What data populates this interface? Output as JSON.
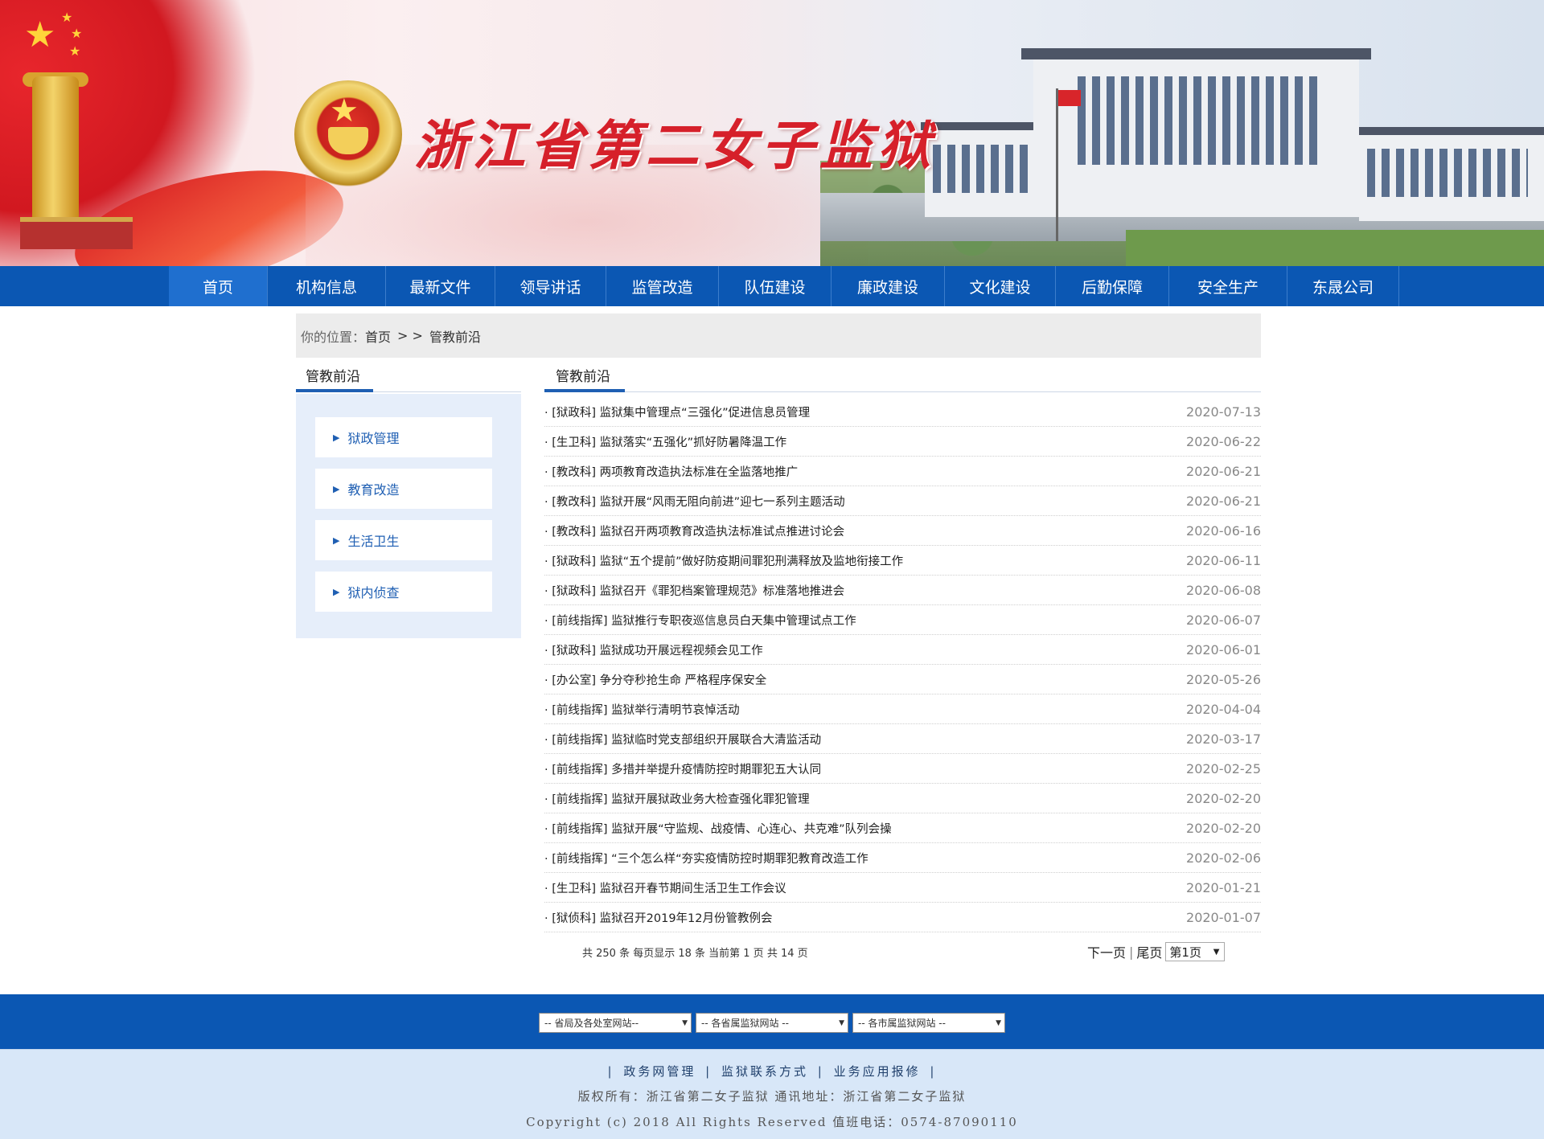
{
  "site": {
    "title": "浙江省第二女子监狱"
  },
  "nav": {
    "items": [
      {
        "label": "首页"
      },
      {
        "label": "机构信息"
      },
      {
        "label": "最新文件"
      },
      {
        "label": "领导讲话"
      },
      {
        "label": "监管改造"
      },
      {
        "label": "队伍建设"
      },
      {
        "label": "廉政建设"
      },
      {
        "label": "文化建设"
      },
      {
        "label": "后勤保障"
      },
      {
        "label": "安全生产"
      },
      {
        "label": "东晟公司"
      }
    ],
    "active_index": 0
  },
  "breadcrumb": {
    "prefix": "你的位置：",
    "home": "首页",
    "separator": "> >",
    "current": "管教前沿"
  },
  "sidebar": {
    "heading": "管教前沿",
    "items": [
      {
        "label": "狱政管理"
      },
      {
        "label": "教育改造"
      },
      {
        "label": "生活卫生"
      },
      {
        "label": "狱内侦查"
      }
    ]
  },
  "main": {
    "heading": "管教前沿",
    "articles": [
      {
        "title": "· [狱政科] 监狱集中管理点“三强化”促进信息员管理",
        "date": "2020-07-13"
      },
      {
        "title": "· [生卫科] 监狱落实“五强化”抓好防暑降温工作",
        "date": "2020-06-22"
      },
      {
        "title": "· [教改科] 两项教育改造执法标准在全监落地推广",
        "date": "2020-06-21"
      },
      {
        "title": "· [教改科] 监狱开展“风雨无阻向前进”迎七一系列主题活动",
        "date": "2020-06-21"
      },
      {
        "title": "· [教改科] 监狱召开两项教育改造执法标准试点推进讨论会",
        "date": "2020-06-16"
      },
      {
        "title": "· [狱政科] 监狱“五个提前”做好防疫期间罪犯刑满释放及监地衔接工作",
        "date": "2020-06-11"
      },
      {
        "title": "· [狱政科] 监狱召开《罪犯档案管理规范》标准落地推进会",
        "date": "2020-06-08"
      },
      {
        "title": "· [前线指挥] 监狱推行专职夜巡信息员白天集中管理试点工作",
        "date": "2020-06-07"
      },
      {
        "title": "· [狱政科] 监狱成功开展远程视频会见工作",
        "date": "2020-06-01"
      },
      {
        "title": "· [办公室] 争分夺秒抢生命 严格程序保安全",
        "date": "2020-05-26"
      },
      {
        "title": "· [前线指挥] 监狱举行清明节哀悼活动",
        "date": "2020-04-04"
      },
      {
        "title": "· [前线指挥] 监狱临时党支部组织开展联合大清监活动",
        "date": "2020-03-17"
      },
      {
        "title": "· [前线指挥] 多措并举提升疫情防控时期罪犯五大认同",
        "date": "2020-02-25"
      },
      {
        "title": "· [前线指挥] 监狱开展狱政业务大检查强化罪犯管理",
        "date": "2020-02-20"
      },
      {
        "title": "· [前线指挥] 监狱开展“守监规、战疫情、心连心、共克难”队列会操",
        "date": "2020-02-20"
      },
      {
        "title": "· [前线指挥] “三个怎么样“夯实疫情防控时期罪犯教育改造工作",
        "date": "2020-02-06"
      },
      {
        "title": "· [生卫科] 监狱召开春节期间生活卫生工作会议",
        "date": "2020-01-21"
      },
      {
        "title": "· [狱侦科] 监狱召开2019年12月份管教例会",
        "date": "2020-01-07"
      }
    ]
  },
  "pager": {
    "info": "共 250 条 每页显示 18 条 当前第 1 页 共 14 页",
    "next": "下一页",
    "bar": "|",
    "last": "尾页",
    "page_select": "第1页"
  },
  "footer": {
    "dropdowns": [
      {
        "label": "-- 省局及各处室网站--"
      },
      {
        "label": "-- 各省属监狱网站 --"
      },
      {
        "label": "-- 各市属监狱网站 --"
      }
    ],
    "links": [
      {
        "label": "政务网管理"
      },
      {
        "label": "监狱联系方式"
      },
      {
        "label": "业务应用报修"
      }
    ],
    "pipe": "|",
    "copyright_line1": "版权所有：浙江省第二女子监狱 通讯地址：浙江省第二女子监狱",
    "copyright_line2": "Copyright (c) 2018 All Rights Reserved 值班电话：0574-87090110"
  },
  "icons": {
    "sidebar_arrow": "triangle-right-icon",
    "select_arrow": "triangle-down-icon"
  },
  "colors": {
    "nav_blue": "#0b57b3",
    "accent_blue": "#1f5fb3",
    "title_red": "#d6202a",
    "sidebar_bg": "#e6eefa",
    "footer_bg": "#d8e7f8"
  }
}
